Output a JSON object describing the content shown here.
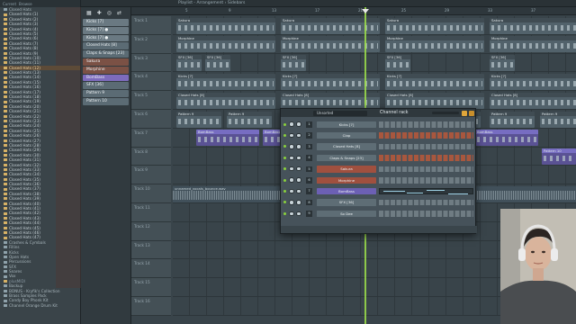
{
  "toolbar": {
    "title": "Playlist - Arrangement › Sidebars"
  },
  "browser": {
    "header": [
      "Current",
      "Browse"
    ],
    "items": [
      {
        "label": "Closed Hats",
        "type": "folder"
      },
      {
        "label": "Closed Hats (1)",
        "type": "file"
      },
      {
        "label": "Closed Hats (2)",
        "type": "file"
      },
      {
        "label": "Closed Hats (3)",
        "type": "file"
      },
      {
        "label": "Closed Hats (4)",
        "type": "file"
      },
      {
        "label": "Closed Hats (5)",
        "type": "file"
      },
      {
        "label": "Closed Hats (6)",
        "type": "file"
      },
      {
        "label": "Closed Hats (7)",
        "type": "file"
      },
      {
        "label": "Closed Hats (8)",
        "type": "file"
      },
      {
        "label": "Closed Hats (9)",
        "type": "file"
      },
      {
        "label": "Closed Hats (10)",
        "type": "file"
      },
      {
        "label": "Closed Hats (11)",
        "type": "file"
      },
      {
        "label": "Closed Hats (12)",
        "type": "sel"
      },
      {
        "label": "Closed Hats (13)",
        "type": "file"
      },
      {
        "label": "Closed Hats (14)",
        "type": "file"
      },
      {
        "label": "Closed Hats (15)",
        "type": "file"
      },
      {
        "label": "Closed Hats (16)",
        "type": "file"
      },
      {
        "label": "Closed Hats (17)",
        "type": "file"
      },
      {
        "label": "Closed Hats (18)",
        "type": "file"
      },
      {
        "label": "Closed Hats (19)",
        "type": "file"
      },
      {
        "label": "Closed Hats (20)",
        "type": "file"
      },
      {
        "label": "Closed Hats (21)",
        "type": "file"
      },
      {
        "label": "Closed Hats (22)",
        "type": "file"
      },
      {
        "label": "Closed Hats (23)",
        "type": "file"
      },
      {
        "label": "Closed Hats (24)",
        "type": "file"
      },
      {
        "label": "Closed Hats (25)",
        "type": "file"
      },
      {
        "label": "Closed Hats (26)",
        "type": "file"
      },
      {
        "label": "Closed Hats (27)",
        "type": "file"
      },
      {
        "label": "Closed Hats (28)",
        "type": "file"
      },
      {
        "label": "Closed Hats (29)",
        "type": "file"
      },
      {
        "label": "Closed Hats (30)",
        "type": "file"
      },
      {
        "label": "Closed Hats (31)",
        "type": "file"
      },
      {
        "label": "Closed Hats (32)",
        "type": "file"
      },
      {
        "label": "Closed Hats (33)",
        "type": "file"
      },
      {
        "label": "Closed Hats (34)",
        "type": "file"
      },
      {
        "label": "Closed Hats (35)",
        "type": "file"
      },
      {
        "label": "Closed Hats (36)",
        "type": "file"
      },
      {
        "label": "Closed Hats (37)",
        "type": "file"
      },
      {
        "label": "Closed Hats (38)",
        "type": "file"
      },
      {
        "label": "Closed Hats (39)",
        "type": "file"
      },
      {
        "label": "Closed Hats (40)",
        "type": "file"
      },
      {
        "label": "Closed Hats (41)",
        "type": "file"
      },
      {
        "label": "Closed Hats (42)",
        "type": "file"
      },
      {
        "label": "Closed Hats (43)",
        "type": "file"
      },
      {
        "label": "Closed Hats (44)",
        "type": "file"
      },
      {
        "label": "Closed Hats (45)",
        "type": "file"
      },
      {
        "label": "Closed Hats (46)",
        "type": "file"
      },
      {
        "label": "Closed Hats (47)",
        "type": "file"
      },
      {
        "label": "Crashes & Cymbals",
        "type": "folder"
      },
      {
        "label": "Fillins",
        "type": "folder"
      },
      {
        "label": "Kicks",
        "type": "folder"
      },
      {
        "label": "Open Hats",
        "type": "folder"
      },
      {
        "label": "Percussions",
        "type": "folder"
      },
      {
        "label": "SFX",
        "type": "folder"
      },
      {
        "label": "Snares",
        "type": "folder"
      },
      {
        "label": "Vox",
        "type": "folder"
      },
      {
        "label": "plusMIDI",
        "type": "dim"
      },
      {
        "label": "Backup",
        "type": "folder"
      },
      {
        "label": "BONUS - Kryfik's Collection",
        "type": "folder"
      },
      {
        "label": "Brass Samples Pack",
        "type": "folder"
      },
      {
        "label": "Candy Boy Phonk Kit",
        "type": "folder"
      },
      {
        "label": "Channel Orange Drum Kit",
        "type": "folder"
      }
    ]
  },
  "patterns": {
    "tools": [
      "▦",
      "✚",
      "◎",
      "⇄"
    ],
    "items": [
      {
        "label": "Kicks [7]",
        "style": "a"
      },
      {
        "label": "Kicks [7] ●",
        "style": "a"
      },
      {
        "label": "Kicks [7] ●",
        "style": "a"
      },
      {
        "label": "Closed Hats [8]",
        "style": ""
      },
      {
        "label": "Claps & Snaps [23]",
        "style": ""
      },
      {
        "label": "Sakura",
        "style": "b"
      },
      {
        "label": "Morphine",
        "style": "b"
      },
      {
        "label": "BomBass",
        "style": "c"
      },
      {
        "label": "SFX [36]",
        "style": ""
      },
      {
        "label": "Pattern 9",
        "style": ""
      },
      {
        "label": "Pattern 10",
        "style": ""
      }
    ]
  },
  "playlist": {
    "ticks": [
      "5",
      "9",
      "13",
      "17",
      "21",
      "25",
      "29",
      "33",
      "37"
    ],
    "tracks": [
      "Track 1",
      "Track 2",
      "Track 3",
      "Track 4",
      "Track 5",
      "Track 6",
      "Track 7",
      "Track 8",
      "Track 9",
      "Track 10",
      "Track 11",
      "Track 12",
      "Track 13",
      "Track 14",
      "Track 15",
      "Track 16"
    ],
    "clip_labels": {
      "sakura": "Sakura",
      "morphine": "Morphine",
      "sfx": "SFX [36]",
      "kicks": "Kicks [7]",
      "hats": "Closed Hats [8]",
      "pattern": "Pattern 9",
      "bombass": "BomBass",
      "pattern10": "Pattern 10",
      "audio": "unnamed_vocals_bounce.wav"
    }
  },
  "rack": {
    "group": "Unsorted",
    "title": "Channel rack",
    "channels": [
      {
        "num": "1",
        "name": "Kicks [7]",
        "style": "",
        "steps": "normal"
      },
      {
        "num": "2",
        "name": "Clap",
        "style": "",
        "steps": "red"
      },
      {
        "num": "3",
        "name": "Closed Hats [8]",
        "style": "",
        "steps": "normal"
      },
      {
        "num": "4",
        "name": "Claps & Snaps [23]",
        "style": "",
        "steps": "red"
      },
      {
        "num": "5",
        "name": "Sakura",
        "style": "red",
        "steps": "normal"
      },
      {
        "num": "6",
        "name": "Morphine",
        "style": "red",
        "steps": "normal"
      },
      {
        "num": "7",
        "name": "BomBass",
        "style": "purple",
        "steps": "roll"
      },
      {
        "num": "8",
        "name": "SFX [36]",
        "style": "",
        "steps": "normal"
      },
      {
        "num": "9",
        "name": "So Dee",
        "style": "",
        "steps": "normal"
      }
    ]
  },
  "colors": {
    "accent": "#9de04a",
    "selection": "#5d4b38",
    "pattern_purple": "#7d6bbc",
    "pattern_red": "#7b5145"
  }
}
